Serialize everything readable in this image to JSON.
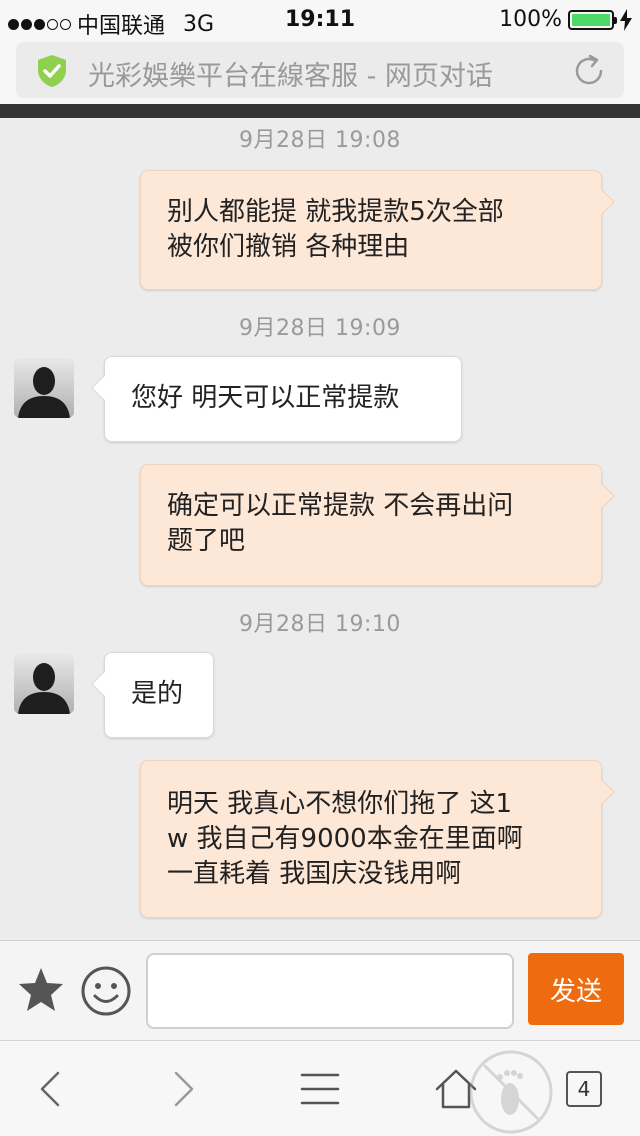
{
  "status_bar": {
    "carrier": "中国联通",
    "network": "3G",
    "time": "19:11",
    "battery": "100%",
    "signal_bars": 3,
    "battery_level": 1.0
  },
  "address_bar": {
    "title": "光彩娛樂平台在線客服 - 网页对话"
  },
  "chat": {
    "messages": [
      {
        "type": "timestamp",
        "text": "9月28日 19:08"
      },
      {
        "type": "outgoing",
        "lines": [
          "别人都能提 就我提款5次全部",
          "被你们撤销 各种理由"
        ]
      },
      {
        "type": "timestamp",
        "text": "9月28日 19:09"
      },
      {
        "type": "incoming",
        "lines": [
          "您好 明天可以正常提款"
        ]
      },
      {
        "type": "outgoing",
        "lines": [
          "确定可以正常提款 不会再出问",
          "题了吧"
        ]
      },
      {
        "type": "timestamp",
        "text": "9月28日 19:10"
      },
      {
        "type": "incoming",
        "lines": [
          "是的"
        ]
      },
      {
        "type": "outgoing",
        "lines": [
          "明天 我真心不想你们拖了 这1",
          "w 我自己有9000本金在里面啊",
          "一直耗着 我国庆没钱用啊"
        ]
      }
    ]
  },
  "input_bar": {
    "message_value": "",
    "send_label": "发送"
  },
  "toolbar": {
    "tab_count": "4"
  },
  "colors": {
    "outgoing_bubble": "#fde7d6",
    "incoming_bubble": "#ffffff",
    "send_button": "#ee6b0f",
    "shield": "#8fd14f",
    "battery": "#4cd964"
  },
  "icons": [
    "shield-check-icon",
    "refresh-icon",
    "star-icon",
    "smiley-icon",
    "back-icon",
    "forward-icon",
    "menu-icon",
    "home-icon",
    "footprint-icon"
  ]
}
